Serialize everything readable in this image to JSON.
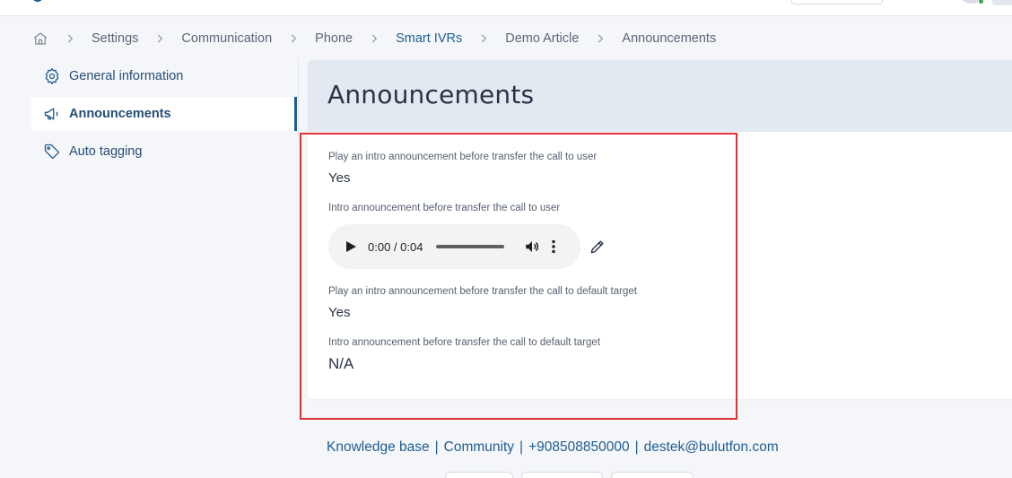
{
  "breadcrumb": {
    "items": [
      "Settings",
      "Communication",
      "Phone",
      "Smart IVRs",
      "Demo Article",
      "Announcements"
    ]
  },
  "sidebar": {
    "items": [
      {
        "label": "General information",
        "icon": "gear-icon"
      },
      {
        "label": "Announcements",
        "icon": "megaphone-icon"
      },
      {
        "label": "Auto tagging",
        "icon": "tag-icon"
      }
    ]
  },
  "main": {
    "title": "Announcements",
    "fields": [
      {
        "label": "Play an intro announcement before transfer the call to user",
        "value": "Yes"
      },
      {
        "label": "Intro announcement before transfer the call to user",
        "audio_time": "0:00 / 0:04"
      },
      {
        "label": "Play an intro announcement before transfer the call to default target",
        "value": "Yes"
      },
      {
        "label": "Intro announcement before transfer the call to default target",
        "value": "N/A"
      }
    ]
  },
  "footer": {
    "links": [
      "Knowledge base",
      "Community",
      "+908508850000",
      "destek@bulutfon.com"
    ]
  },
  "colors": {
    "accent": "#1f5d8f",
    "highlight": "#e0303a",
    "header_bg": "#e3e9f1",
    "page_bg": "#f4f6f9"
  }
}
